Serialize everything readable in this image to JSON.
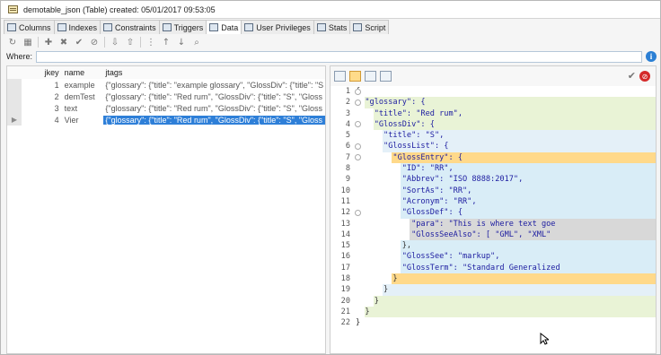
{
  "window": {
    "title": "demotable_json (Table) created: 05/01/2017 09:53:05"
  },
  "tabs": [
    {
      "label": "Columns",
      "icon": "columns-icon"
    },
    {
      "label": "Indexes",
      "icon": "indexes-icon"
    },
    {
      "label": "Constraints",
      "icon": "constraints-icon"
    },
    {
      "label": "Triggers",
      "icon": "triggers-icon"
    },
    {
      "label": "Data",
      "icon": "data-icon"
    },
    {
      "label": "User Privileges",
      "icon": "user-privileges-icon"
    },
    {
      "label": "Stats",
      "icon": "stats-icon"
    },
    {
      "label": "Script",
      "icon": "script-icon"
    }
  ],
  "toolbar_icons": [
    "refresh-icon",
    "grid-icon",
    "add-icon",
    "delete-icon",
    "commit-icon",
    "cancel-icon",
    "import-icon",
    "export-icon",
    "filter-icon",
    "sort-asc-icon",
    "sort-desc-icon",
    "find-icon"
  ],
  "where": {
    "label": "Where:",
    "value": ""
  },
  "grid": {
    "columns": [
      "jkey",
      "name",
      "jtags"
    ],
    "rows": [
      {
        "jkey": "1",
        "name": "example",
        "jtags": "{\"glossary\": {\"title\": \"example glossary\", \"GlossDiv\": {\"title\": \"S"
      },
      {
        "jkey": "2",
        "name": "demTest",
        "jtags": "{\"glossary\": {\"title\": \"Red rum\", \"GlossDiv\": {\"title\": \"S\", \"Gloss"
      },
      {
        "jkey": "3",
        "name": "text",
        "jtags": "{\"glossary\": {\"title\": \"Red rum\", \"GlossDiv\": {\"title\": \"S\", \"Gloss"
      },
      {
        "jkey": "4",
        "name": "Vier",
        "jtags": "{\"glossary\": {\"title\": \"Red rum\", \"GlossDiv\": {\"title\": \"S\", \"Gloss"
      }
    ]
  },
  "editor": {
    "lines": [
      {
        "n": "1",
        "text": "{"
      },
      {
        "n": "2",
        "text": "  \"glossary\": {"
      },
      {
        "n": "3",
        "text": "    \"title\": \"Red rum\","
      },
      {
        "n": "4",
        "text": "    \"GlossDiv\": {"
      },
      {
        "n": "5",
        "text": "      \"title\": \"S\","
      },
      {
        "n": "6",
        "text": "      \"GlossList\": {"
      },
      {
        "n": "7",
        "text": "        \"GlossEntry\": {"
      },
      {
        "n": "8",
        "text": "          \"ID\": \"RR\","
      },
      {
        "n": "9",
        "text": "          \"Abbrev\": \"ISO 8888:2017\","
      },
      {
        "n": "10",
        "text": "          \"SortAs\": \"RR\","
      },
      {
        "n": "11",
        "text": "          \"Acronym\": \"RR\","
      },
      {
        "n": "12",
        "text": "          \"GlossDef\": {"
      },
      {
        "n": "13",
        "text": "            \"para\": \"This is where text goe"
      },
      {
        "n": "14",
        "text": "            \"GlossSeeAlso\": [ \"GML\", \"XML\""
      },
      {
        "n": "15",
        "text": "          },"
      },
      {
        "n": "16",
        "text": "          \"GlossSee\": \"markup\","
      },
      {
        "n": "17",
        "text": "          \"GlossTerm\": \"Standard Generalized"
      },
      {
        "n": "18",
        "text": "        }"
      },
      {
        "n": "19",
        "text": "      }"
      },
      {
        "n": "20",
        "text": "    }"
      },
      {
        "n": "21",
        "text": "  }"
      },
      {
        "n": "22",
        "text": "}"
      }
    ]
  }
}
